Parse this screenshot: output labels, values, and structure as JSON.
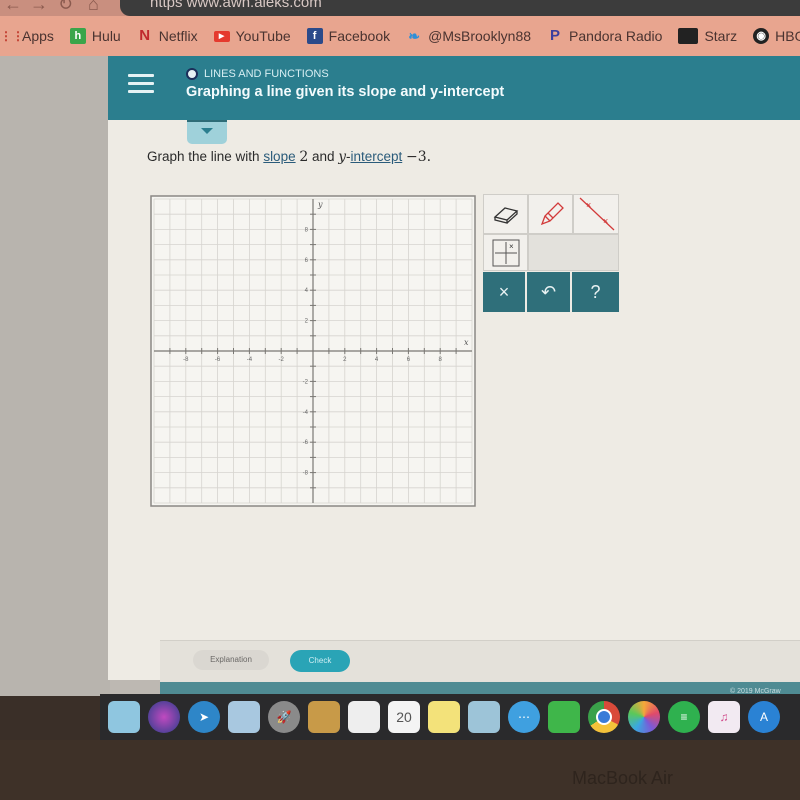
{
  "browser": {
    "url_partial": "https  www.awn.aleks.com",
    "bookmarks": [
      {
        "label": "Apps",
        "icon": "apps-grid-icon",
        "color": "#c0392b"
      },
      {
        "label": "Hulu",
        "icon": "hulu-icon",
        "color": "#3aa54a"
      },
      {
        "label": "Netflix",
        "icon": "netflix-icon",
        "color": "#c0282d"
      },
      {
        "label": "YouTube",
        "icon": "youtube-icon",
        "color": "#e53a2e"
      },
      {
        "label": "Facebook",
        "icon": "facebook-icon",
        "color": "#2b4a8a"
      },
      {
        "label": "@MsBrooklyn88",
        "icon": "twitter-icon",
        "color": "#2d8fd8"
      },
      {
        "label": "Pandora Radio",
        "icon": "pandora-icon",
        "color": "#3b3f9e"
      },
      {
        "label": "Starz",
        "icon": "starz-icon",
        "color": "#222222"
      },
      {
        "label": "HBO",
        "icon": "hbo-icon",
        "color": "#222222"
      }
    ]
  },
  "header": {
    "section": "LINES AND FUNCTIONS",
    "title": "Graphing a line given its slope and y-intercept"
  },
  "problem": {
    "prefix": "Graph the line with ",
    "slope_link": "slope",
    "slope_value": "2",
    "and": " and ",
    "y_var": "y",
    "intercept_link": "intercept",
    "intercept_value": "−3."
  },
  "graph": {
    "x_label": "x",
    "y_label": "y",
    "x_range": [
      -10,
      10
    ],
    "y_range": [
      -10,
      10
    ],
    "x_ticks": [
      "-8",
      "-6",
      "-4",
      "-2",
      "2",
      "4",
      "6",
      "8"
    ],
    "y_ticks": [
      "8",
      "6",
      "4",
      "2",
      "-2",
      "-4",
      "-6",
      "-8"
    ]
  },
  "tools": {
    "eraser": "eraser-icon",
    "pencil": "pencil-icon",
    "line": "line-tool-icon",
    "point": "point-grid-icon",
    "clear_label": "×",
    "undo_label": "↶",
    "help_label": "?"
  },
  "footer": {
    "explanation_label": "Explanation",
    "check_label": "Check",
    "copyright": "© 2019 McGraw"
  },
  "dock": {
    "calendar_day": "20"
  },
  "hardware": {
    "label": "MacBook Air"
  }
}
